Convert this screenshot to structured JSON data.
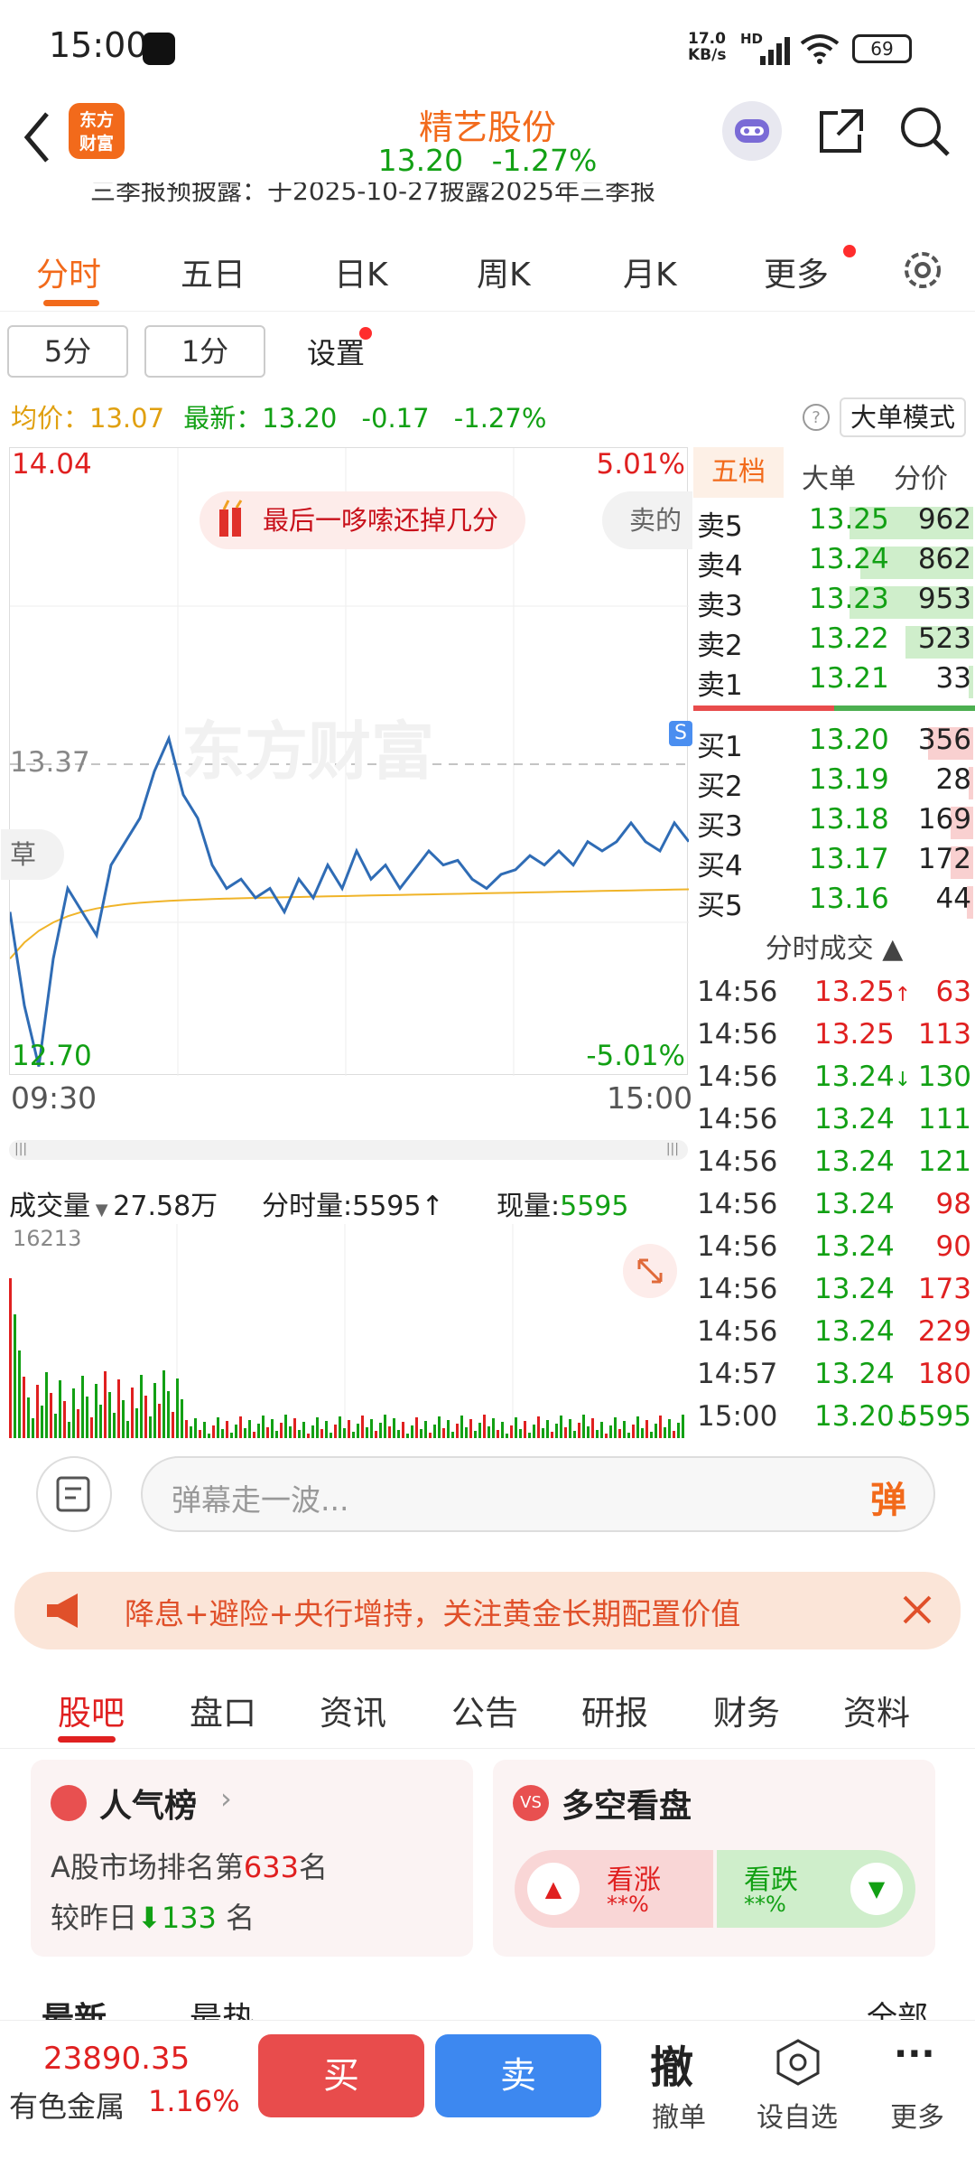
{
  "status": {
    "time": "15:00",
    "net_speed": "17.0",
    "net_unit": "KB/s",
    "hd": "HD",
    "battery": "69"
  },
  "header": {
    "stock_name": "精艺股份",
    "price": "13.20",
    "change_pct": "-1.27%",
    "logo_line1": "东方",
    "logo_line2": "财富"
  },
  "ticker": "三季报预披露：于2025-10-27披露2025年三季报",
  "main_tabs": [
    "分时",
    "五日",
    "日K",
    "周K",
    "月K",
    "更多"
  ],
  "period_buttons": [
    "5分",
    "1分",
    "设置"
  ],
  "avg_line": {
    "avg_label": "均价：",
    "avg_value": "13.07",
    "latest_label": "最新：",
    "latest_value": "13.20",
    "change": "-0.17",
    "pct": "-1.27%"
  },
  "mode_button": "大单模式",
  "chart": {
    "high": "14.04",
    "high_pct": "5.01%",
    "low": "12.70",
    "low_pct": "-5.01%",
    "prev_close": "13.37",
    "start_time": "09:30",
    "end_time": "15:00",
    "bubble": "最后一哆嗦还掉几分",
    "side_bubble": "卖的",
    "left_tag": "草",
    "watermark": "东方财富",
    "s_marker": "S"
  },
  "book_tabs": [
    "五档",
    "大单",
    "分价"
  ],
  "asks": [
    {
      "label": "卖5",
      "price": "13.25",
      "vol": "962",
      "bar": 0.55
    },
    {
      "label": "卖4",
      "price": "13.24",
      "vol": "862",
      "bar": 0.5
    },
    {
      "label": "卖3",
      "price": "13.23",
      "vol": "953",
      "bar": 0.55
    },
    {
      "label": "卖2",
      "price": "13.22",
      "vol": "523",
      "bar": 0.3
    },
    {
      "label": "卖1",
      "price": "13.21",
      "vol": "33",
      "bar": 0.02
    }
  ],
  "bids": [
    {
      "label": "买1",
      "price": "13.20",
      "vol": "356",
      "bar": 0.2
    },
    {
      "label": "买2",
      "price": "13.19",
      "vol": "28",
      "bar": 0.02
    },
    {
      "label": "买3",
      "price": "13.18",
      "vol": "169",
      "bar": 0.1
    },
    {
      "label": "买4",
      "price": "13.17",
      "vol": "172",
      "bar": 0.1
    },
    {
      "label": "买5",
      "price": "13.16",
      "vol": "44",
      "bar": 0.03
    }
  ],
  "trades_title": "分时成交",
  "trades": [
    {
      "time": "14:56",
      "price": "13.25",
      "arrow": "↑",
      "vol": "63",
      "color": "red"
    },
    {
      "time": "14:56",
      "price": "13.25",
      "arrow": "",
      "vol": "113",
      "color": "red"
    },
    {
      "time": "14:56",
      "price": "13.24",
      "arrow": "↓",
      "vol": "130",
      "color": "green"
    },
    {
      "time": "14:56",
      "price": "13.24",
      "arrow": "",
      "vol": "111",
      "color": "green"
    },
    {
      "time": "14:56",
      "price": "13.24",
      "arrow": "",
      "vol": "121",
      "color": "green"
    },
    {
      "time": "14:56",
      "price": "13.24",
      "arrow": "",
      "vol": "98",
      "color": "red"
    },
    {
      "time": "14:56",
      "price": "13.24",
      "arrow": "",
      "vol": "90",
      "color": "red"
    },
    {
      "time": "14:56",
      "price": "13.24",
      "arrow": "",
      "vol": "173",
      "color": "red"
    },
    {
      "time": "14:56",
      "price": "13.24",
      "arrow": "",
      "vol": "229",
      "color": "red"
    },
    {
      "time": "14:57",
      "price": "13.24",
      "arrow": "",
      "vol": "180",
      "color": "red"
    },
    {
      "time": "15:00",
      "price": "13.20",
      "arrow": "↓",
      "vol": "5595",
      "color": "green"
    }
  ],
  "volume": {
    "label": "成交量",
    "total": "27.58万",
    "time_vol_label": "分时量:",
    "time_vol": "5595↑",
    "cur_label": "现量:",
    "cur": "5595",
    "max": "16213"
  },
  "danmu": {
    "placeholder": "弹幕走一波...",
    "btn": "弹"
  },
  "banner": "降息+避险+央行增持，关注黄金长期配置价值",
  "sub_tabs": [
    "股吧",
    "盘口",
    "资讯",
    "公告",
    "研报",
    "财务",
    "资料"
  ],
  "popularity": {
    "title": "人气榜",
    "rank_prefix": "A股市场排名第",
    "rank": "633",
    "rank_suffix": "名",
    "compare_prefix": "较昨日",
    "compare": "133",
    "compare_suffix": "名"
  },
  "longshort": {
    "title": "多空看盘",
    "up_label": "看涨",
    "up_val": "**%",
    "down_label": "看跌",
    "down_val": "**%"
  },
  "feed_tabs": {
    "latest": "最新",
    "hot": "最热",
    "all": "全部"
  },
  "bottom": {
    "index_value": "23890.35",
    "index_name": "有色金属",
    "index_pct": "1.16%",
    "buy": "买",
    "sell": "卖",
    "cancel": "撤",
    "cancel_label": "撤单",
    "watch_label": "设自选",
    "more_label": "更多"
  }
}
